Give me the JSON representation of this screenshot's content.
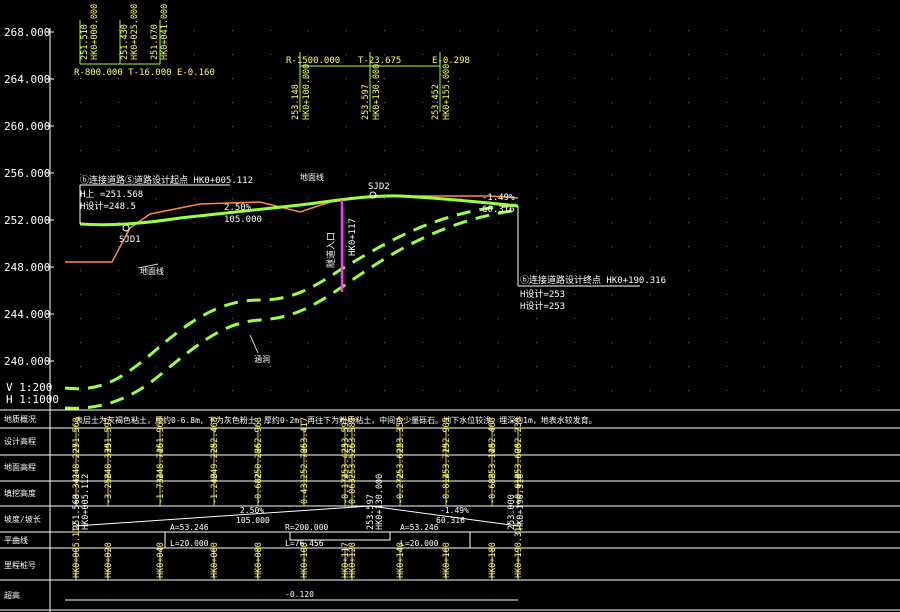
{
  "colors": {
    "design_line": "#9cff3c",
    "ground_line": "#ff8a3c",
    "culvert_dash": "#9cff3c",
    "tunnel_marker": "#ff33ff",
    "grid": "#6a6a6a",
    "text": "#ffffff",
    "label": "#ffff55"
  },
  "axis": {
    "y_ticks": [
      "268.000",
      "264.000",
      "260.000",
      "256.000",
      "252.000",
      "248.000",
      "244.000",
      "240.000"
    ],
    "ylim": [
      236.0,
      268.0
    ]
  },
  "scale": {
    "v": "V 1:200",
    "h": "H 1:1000"
  },
  "top_labels": {
    "vc1": {
      "elevations": [
        "251.510",
        "251.430",
        "251.670"
      ],
      "stations": [
        "HK0+000.000",
        "HK0+025.000",
        "HK0+041.000"
      ],
      "params": "R-800.000 T-16.000 E-0.160"
    },
    "vc2": {
      "params_r": "R-1500.000",
      "params_t": "T-23.675",
      "params_e": "E-0.298",
      "elevations": [
        "253.148",
        "253.597",
        "253.452"
      ],
      "stations": [
        "HK0+100.000",
        "HK0+130.000",
        "HK0+155.000"
      ]
    }
  },
  "annotations": {
    "start_title": "ⓑ连接道路Ⓢ道路设计起点 HK0+005.112",
    "start_h": "H上 =251.568",
    "start_hd": "H设计=248.5",
    "end_title": "ⓑ连接道路设计终点 HK0+190.316",
    "end_h1": "H设计=253",
    "end_h2": "H设计=253",
    "sjd1": "SJD1",
    "sjd2": "SJD2",
    "slope1": "2.50%",
    "len1": "105.000",
    "slope2": "-1.49%",
    "len2": "60.316",
    "tunnel_label": "隧道入口",
    "tunnel_station": "HK0+117",
    "ground_label": "地面线",
    "culvert_label": "涵洞",
    "ground_label2": "地面线"
  },
  "table": {
    "row_labels": [
      "地质概况",
      "设计高程",
      "地面高程",
      "填挖高度",
      "坡度/坡长",
      "平曲线",
      "里程桩号",
      "超高"
    ],
    "geology_note": "表层土为灰褐色粘土，厚约0-6.8m，下为灰色粉土，厚约0-2m，再往下为粉质粘土，中间含少量砾石。地下水位较浅，埋深约1m，地表水较发育。",
    "stations": [
      "HK0+005.112",
      "HK0+020",
      "HK0+040",
      "HK0+060",
      "HK0+080",
      "HK0+100",
      "HK0+117",
      "HK0+120",
      "HK0+140",
      "HK0+160",
      "HK0+180",
      "HK0+190.316"
    ],
    "design_elev": [
      "251.568",
      "251.597",
      "251.968",
      "252.468",
      "252.968",
      "253.417",
      "253.597",
      "253.589",
      "253.350",
      "252.905",
      "252.460",
      "252.230"
    ],
    "ground_elev": [
      "248.227",
      "248.339",
      "248.746",
      "249.228",
      "250.286",
      "252.786",
      "253.423",
      "253.526",
      "253.622",
      "253.719",
      "253.148",
      "253.600"
    ],
    "fill_cut": [
      "-3.341",
      "-3.258",
      "-1.734",
      "-1.240",
      "-0.682",
      "0.431",
      "-0.174",
      "0.063",
      "-0.272",
      "-0.814",
      "-0.688",
      "-0.010"
    ],
    "grade_1": "2.50%",
    "grade_1_len": "105.000",
    "grade_2": "-1.49%",
    "grade_2_len": "60.316",
    "grade_pt": "253.597",
    "grade_pt2": "HK0+130.000",
    "grade_start": "251.568",
    "grade_start2": "HK0+005.112",
    "grade_end": "253.000",
    "grade_end2": "HK0+190.316",
    "curve_a1": "A=53.246",
    "curve_l1": "L=20.000",
    "curve_r": "R=200.000",
    "curve_l2": "L=76.456",
    "curve_a2": "A=53.246",
    "curve_l3": "L=20.000",
    "superelev": "-0.120"
  }
}
